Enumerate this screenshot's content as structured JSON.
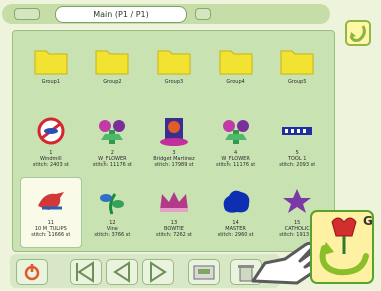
{
  "header": {
    "title": "Main (P1 / P1)"
  },
  "accent_colors": {
    "background": "#eef3dc",
    "panel": "#c9e2b2",
    "folder": "#f2e232",
    "selected_cell": "#f9fbe8",
    "button_highlight": "#58a12c"
  },
  "grid": {
    "items": [
      {
        "type": "folder",
        "icon": "folder-icon",
        "label": "Group1"
      },
      {
        "type": "folder",
        "icon": "folder-icon",
        "label": "Group2"
      },
      {
        "type": "folder",
        "icon": "folder-icon",
        "label": "Group3"
      },
      {
        "type": "folder",
        "icon": "folder-icon",
        "label": "Group4"
      },
      {
        "type": "folder",
        "icon": "folder-icon",
        "label": "Group5"
      },
      {
        "type": "design",
        "icon": "no-sign-design-icon",
        "label": "1\nWindmill\nstitch: 2403 st"
      },
      {
        "type": "design",
        "icon": "floral-design-icon",
        "label": "2\nW_FLOWER\nstitch: 11176 st"
      },
      {
        "type": "design",
        "icon": "portrait-design-icon",
        "label": "3\nBridget Martinez\nstitch: 17989 st"
      },
      {
        "type": "design",
        "icon": "floral-design-icon",
        "label": "4\nW_FLOWER\nstitch: 11176 st"
      },
      {
        "type": "design",
        "icon": "text-design-icon",
        "label": "5\nTOOL 1\nstitch: 2093 st"
      },
      {
        "type": "design",
        "icon": "bird-design-icon",
        "label": "11\n10 M_TULIPS\nstitch: 11666 st",
        "selected": true
      },
      {
        "type": "design",
        "icon": "plant-design-icon",
        "label": "12\nVine\nstitch: 3766 st"
      },
      {
        "type": "design",
        "icon": "crown-design-icon",
        "label": "13\nBOWTIE\nstitch: 7262 st"
      },
      {
        "type": "design",
        "icon": "blob-design-icon",
        "label": "14\nMASTER\nstitch: 2960 st"
      },
      {
        "type": "design",
        "icon": "star-design-icon",
        "label": "15\nCATHOLIC\nstitch: 1913 st"
      }
    ]
  },
  "toolbar": {
    "buttons": [
      {
        "name": "power-button",
        "icon": "power-icon"
      },
      {
        "name": "first-page-button",
        "icon": "first-page-icon"
      },
      {
        "name": "prev-page-button",
        "icon": "prev-page-icon"
      },
      {
        "name": "next-page-button",
        "icon": "next-page-icon"
      },
      {
        "name": "machine-button",
        "icon": "machine-icon"
      },
      {
        "name": "delete-button",
        "icon": "trash-icon"
      }
    ]
  },
  "g_button": {
    "label": "G",
    "icon": "tulip-return-icon"
  }
}
